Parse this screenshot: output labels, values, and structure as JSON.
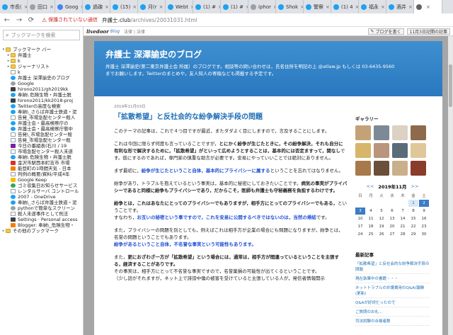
{
  "tabs": [
    {
      "label": "市長(",
      "color": "#1da1f2",
      "active": false
    },
    {
      "label": "田口",
      "color": "#9aa0a6",
      "active": false
    },
    {
      "label": "Goog",
      "color": "#4285f4",
      "active": false
    },
    {
      "label": "過疎",
      "color": "#1da1f2",
      "active": false
    },
    {
      "label": "(15)",
      "color": "#1da1f2",
      "active": false
    },
    {
      "label": "月(r",
      "color": "#1da1f2",
      "active": false
    },
    {
      "label": "Webt",
      "color": "#1da1f2",
      "active": false
    },
    {
      "label": "(1) #",
      "color": "#1da1f2",
      "active": false
    },
    {
      "label": "(1) #",
      "color": "#1da1f2",
      "active": false
    },
    {
      "label": "iphor",
      "color": "#9aa0a6",
      "active": false
    },
    {
      "label": "Shok",
      "color": "#1da1f2",
      "active": false
    },
    {
      "label": "警察",
      "color": "#1da1f2",
      "active": false
    },
    {
      "label": "(1) 4",
      "color": "#1da1f2",
      "active": false
    },
    {
      "label": "福永",
      "color": "#1da1f2",
      "active": false
    },
    {
      "label": "酒井",
      "color": "#1da1f2",
      "active": false
    },
    {
      "label": "",
      "color": "#5f6368",
      "active": true
    }
  ],
  "toolbar": {
    "security_label": "保護されていない通信",
    "url_host": "弁護士.club",
    "url_path": "/archives/20031031.html"
  },
  "sidebar": {
    "search_placeholder": "ブックマークを検索",
    "items": [
      {
        "label": "ブックマーク バー",
        "icon": "folder",
        "indent": 0,
        "twisty": "▾"
      },
      {
        "label": "弁護士",
        "icon": "folder",
        "indent": 1,
        "twisty": "▸"
      },
      {
        "label": "k",
        "icon": "folder",
        "indent": 1,
        "twisty": "▸"
      },
      {
        "label": "ジャーナリスト",
        "icon": "folder",
        "indent": 1,
        "twisty": "▸"
      },
      {
        "label": "k",
        "icon": "page",
        "indent": 1,
        "twisty": ""
      },
      {
        "label": "弁護士 深澤諭史のブログ",
        "icon": "blue",
        "indent": 1,
        "twisty": ""
      },
      {
        "label": "Google",
        "icon": "gray",
        "indent": 1,
        "twisty": ""
      },
      {
        "label": "hirono2011/gh2019kk",
        "icon": "dark",
        "indent": 1,
        "twisty": ""
      },
      {
        "label": "奉納\\ 危険生物・弁護士脱",
        "icon": "blue",
        "indent": 1,
        "twisty": ""
      },
      {
        "label": "hirono2011/kk2018-proj",
        "icon": "dark",
        "indent": 1,
        "twisty": ""
      },
      {
        "label": "Twitterの高度な検索",
        "icon": "blue",
        "indent": 1,
        "twisty": ""
      },
      {
        "label": "奉納\\_さらば弁護士鉄道・泥",
        "icon": "blue",
        "indent": 1,
        "twisty": ""
      },
      {
        "label": "告発_市場急配センター殺人",
        "icon": "page",
        "indent": 1,
        "twisty": ""
      },
      {
        "label": "弁護士会・最高検察庁の",
        "icon": "blue",
        "indent": 1,
        "twisty": ""
      },
      {
        "label": "弁護士会・最高検察庁懲中",
        "icon": "blue",
        "indent": 1,
        "twisty": ""
      },
      {
        "label": "告発\\_市場急配センター殺",
        "icon": "page",
        "indent": 1,
        "twisty": ""
      },
      {
        "label": "告発_市場急配センター殺",
        "icon": "page",
        "indent": 1,
        "twisty": ""
      },
      {
        "label": "今日の番組表(石川 / 19",
        "icon": "purple",
        "indent": 1,
        "twisty": ""
      },
      {
        "label": "市場急配センター殺人未遂",
        "icon": "page",
        "indent": 1,
        "twisty": ""
      },
      {
        "label": "奉納\\ 危険生物・弁護士脱",
        "icon": "blue",
        "indent": 1,
        "twisty": ""
      },
      {
        "label": "金沢市駅西本町吉市 市場",
        "icon": "red",
        "indent": 1,
        "twisty": ""
      },
      {
        "label": "能登町の1時間天気 - 日本",
        "icon": "orange",
        "indent": 1,
        "twisty": ""
      },
      {
        "label": "判例の概要/資料/平成4年",
        "icon": "page",
        "indent": 1,
        "twisty": ""
      },
      {
        "label": "Google Keep",
        "icon": "yellow",
        "indent": 1,
        "twisty": ""
      },
      {
        "label": "ゴミ収集日お知らせサービス",
        "icon": "green",
        "indent": 1,
        "twisty": ""
      },
      {
        "label": "レンタルサーバ コントロール",
        "icon": "page",
        "indent": 1,
        "twisty": ""
      },
      {
        "label": "2007 - OneDrive",
        "icon": "blue",
        "indent": 1,
        "twisty": ""
      },
      {
        "label": "奉納\\_さらば弁護士鉄道・泥",
        "icon": "blue",
        "indent": 1,
        "twisty": ""
      },
      {
        "label": "pythonで簡単なスクリーン",
        "icon": "gray",
        "indent": 1,
        "twisty": ""
      },
      {
        "label": "殺人未遂事件として刑法",
        "icon": "page",
        "indent": 1,
        "twisty": ""
      },
      {
        "label": "Settings · Personal access",
        "icon": "dark",
        "indent": 1,
        "twisty": ""
      },
      {
        "label": "Blogger: 奉納\\_危険生物・",
        "icon": "orange",
        "indent": 1,
        "twisty": ""
      },
      {
        "label": "その他のブックマーク",
        "icon": "folder",
        "indent": 0,
        "twisty": "▸"
      }
    ]
  },
  "livedoor": {
    "logo": "livedoor",
    "blog": "Blog",
    "sep": "法律 | 法律",
    "follow_button": "ブログを書く",
    "update": "11月3日記開の記事"
  },
  "blog": {
    "title": "弁護士 深澤諭史のブログ",
    "description": "弁護士 深澤諭史(第二東京弁護士会 所属）のブログです。相談等の問い合わせは，氏名住所を明記の上 @atlaw.jp もしくは 03-6435-9560 までお願いします。Twitterのまとめや，友人知人の寄稿なども掲載する予定です。"
  },
  "post": {
    "date": "2019年11月03日",
    "title": "「拡散希望」と反社会的な紛争解決手段の問題",
    "p1": "このテーマの記事は，これで４つ目ですが最近，またダダよく目にしますので，言及することにします。",
    "p2_a": "これは今回に限らず何度も言っていることですが，",
    "p2_b": "とにかく紛争が生じたときに，その紛争解決，それも自分に有利な形で解決するために，「拡散希望」がといって広めようとすることは，基本的には否定ますって，関なし",
    "p2_c": "です。仮にするのであれば，専門家の慎重な助言が必要です。安易にやっていいことでは絶対にありません。",
    "p3_a": "まず最初に，",
    "p3_b": "紛争が生じたということ自体，基本的にプライバシーに属する",
    "p3_c": "ということを忘れてはなりません。",
    "p4_a": "紛争があり，トラブルを抱えているという事実は，基本的に秘密にしておきたいことです。",
    "p4_b": "病気の事実がプライバシーであると同様に紛争もプライバシーであり，だからこそ，医師も弁護士も守秘義務を負担するわけです。",
    "p5_a": "紛争とは，これはあなたにとってのプライバシーでもありますが，相手方にとってのプライバシーでもある，",
    "p5_b": "ということです。",
    "p5_c": "すなわち，",
    "p5_d": "お互いの秘密という事ですので，これを安易に公開するべきではないのは，当然の帰結",
    "p5_e": "です。",
    "p6_a": "また，プライバシーの問題を別としても，例えばこれは相手方が企業の場合にも問題になりますが，紛争とは，名誉の問題ということでもあります。",
    "p6_b": "紛争があるということ自体，不名誉な事実という可能性もあります。",
    "p7_a": "また，",
    "p7_b": "更におざわざ一方が「拡散希望」という場合には，通常は，相手方が間違っているということを主張する，経済することがありです。",
    "p7_c": "その事実は，相手方にとって不名誉な事実ですので，名誉棄損の可能性が出てくるということです。",
    "p7_d": "（少し話がそれますが，ネット上で誹謗中傷の被害を受けていると主張している人が，発信者情報開示"
  },
  "side": {
    "gallery_title": "ギャラリー",
    "gallery_colors": [
      "#c4a277",
      "#7d8a96",
      "#dcd1c2",
      "#8c6a4b",
      "#d7b56a",
      "#b9957c",
      "#5b6b78",
      "#e0c79a",
      "#a67a4a",
      "#6b4f3a",
      "#c9b08a",
      "#8a3d2a"
    ],
    "calendar_title": "2019年11月",
    "cal_prev": "<<",
    "cal_next": ">>",
    "weekdays": [
      "日",
      "月",
      "火",
      "水",
      "木",
      "金",
      "土"
    ],
    "days": [
      {
        "d": "",
        "s": ""
      },
      {
        "d": "",
        "s": ""
      },
      {
        "d": "",
        "s": ""
      },
      {
        "d": "",
        "s": ""
      },
      {
        "d": "",
        "s": ""
      },
      {
        "d": "1",
        "s": "hasp"
      },
      {
        "d": "2",
        "s": "cur"
      },
      {
        "d": "3",
        "s": "cur"
      },
      {
        "d": "4",
        "s": ""
      },
      {
        "d": "5",
        "s": ""
      },
      {
        "d": "6",
        "s": ""
      },
      {
        "d": "7",
        "s": ""
      },
      {
        "d": "8",
        "s": ""
      },
      {
        "d": "9",
        "s": ""
      },
      {
        "d": "10",
        "s": ""
      },
      {
        "d": "11",
        "s": ""
      },
      {
        "d": "12",
        "s": ""
      },
      {
        "d": "13",
        "s": ""
      },
      {
        "d": "14",
        "s": ""
      },
      {
        "d": "15",
        "s": ""
      },
      {
        "d": "16",
        "s": ""
      },
      {
        "d": "17",
        "s": ""
      },
      {
        "d": "18",
        "s": ""
      },
      {
        "d": "19",
        "s": ""
      },
      {
        "d": "20",
        "s": ""
      },
      {
        "d": "21",
        "s": ""
      },
      {
        "d": "22",
        "s": ""
      },
      {
        "d": "23",
        "s": ""
      },
      {
        "d": "24",
        "s": ""
      },
      {
        "d": "25",
        "s": ""
      },
      {
        "d": "26",
        "s": ""
      },
      {
        "d": "27",
        "s": ""
      },
      {
        "d": "28",
        "s": ""
      },
      {
        "d": "29",
        "s": ""
      },
      {
        "d": "30",
        "s": ""
      }
    ],
    "recent_title": "最新記事",
    "recent": [
      "「拡散希望」と反社会的な紛争解決手段の問題",
      "現在執筆中の書籍・・・",
      "ネットトラブルの弁護費用のQ&A(報酬 (更新)",
      "Q&Aが好評だったので",
      "ご質問のお礼...",
      "司法試験の合格者数"
    ]
  }
}
